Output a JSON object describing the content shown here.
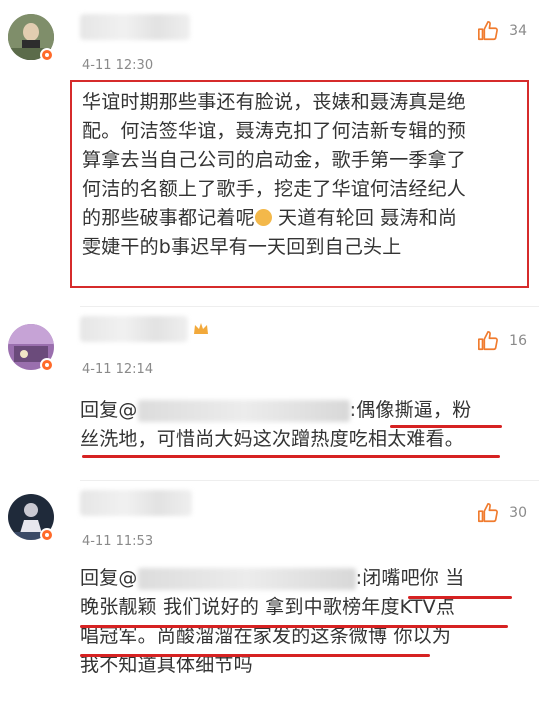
{
  "comments": [
    {
      "time": "4-11 12:30",
      "likes": "34",
      "lines": [
        "华谊时期那些事还有脸说，丧婊和聂涛真是绝",
        "配。何洁签华谊，聂涛克扣了何洁新专辑的预",
        "算拿去当自己公司的启动金，歌手第一季拿了",
        "何洁的名额上了歌手，挖走了华谊何洁经纪人",
        "的那些破事都记着呢",
        " 天道有轮回 聂涛和尚",
        "雯婕干的b事迟早有一天回到自己头上"
      ]
    },
    {
      "time": "4-11 12:14",
      "likes": "16",
      "reply_prefix": "回复@",
      "lines": [
        ":偶像撕逼，粉",
        "丝洗地，可惜尚大妈这次蹭热度吃相太难看。"
      ]
    },
    {
      "time": "4-11 11:53",
      "likes": "30",
      "reply_prefix": "回复@",
      "lines": [
        ":闭嘴吧你 当",
        "晚张靓颖 我们说好的 拿到中歌榜年度KTV点",
        "唱冠军。尚酸溜溜在家发的这条微博 你以为",
        "我不知道具体细节吗"
      ]
    }
  ],
  "colors": {
    "highlight_red": "#d62b2b",
    "like_orange": "#f07b2e",
    "meta_gray": "#8a8a8a"
  }
}
